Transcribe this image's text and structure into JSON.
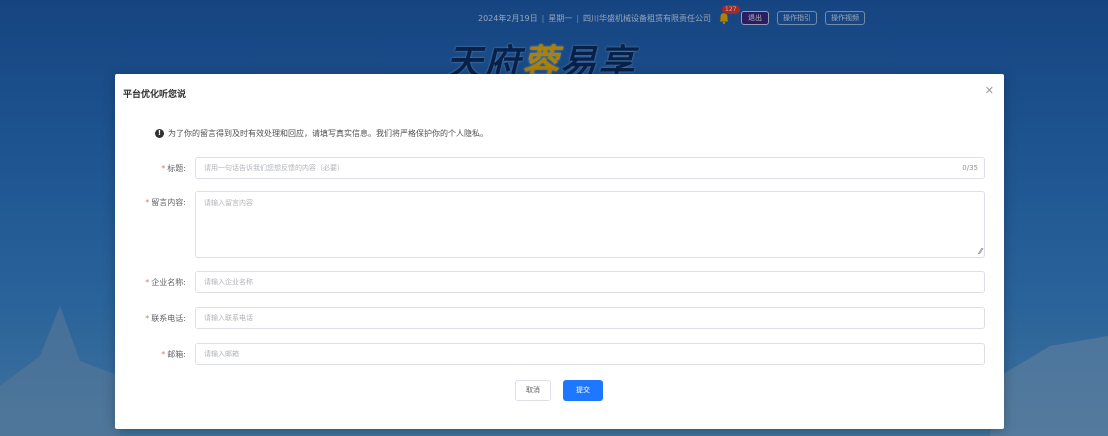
{
  "header": {
    "date": "2024年2月19日",
    "weekday": "星期一",
    "company": "四川华盛机械设备租赁有限责任公司",
    "notification_count": "127",
    "logout_label": "退出",
    "guide_label": "操作指引",
    "video_label": "操作视频",
    "brand_part1": "天府",
    "brand_highlight": "蓉",
    "brand_part2": "易享"
  },
  "modal": {
    "title": "平台优化听您说",
    "close_icon": "close-icon",
    "notice": "为了你的留言得到及时有效处理和回应，请填写真实信息。我们将严格保护你的个人隐私。",
    "fields": [
      {
        "label": "标题:",
        "placeholder": "请用一句话告诉我们您想反馈的内容（必要）",
        "counter": "0/35"
      },
      {
        "label": "留言内容:",
        "placeholder": "请输入留言内容"
      },
      {
        "label": "企业名称:",
        "placeholder": "请输入企业名称"
      },
      {
        "label": "联系电话:",
        "placeholder": "请输入联系电话"
      },
      {
        "label": "邮箱:",
        "placeholder": "请输入邮箱"
      }
    ],
    "cancel_label": "取消",
    "submit_label": "提交"
  },
  "colors": {
    "primary": "#1e78ff",
    "required": "#f56c6c",
    "brand_highlight": "#f3b300"
  }
}
